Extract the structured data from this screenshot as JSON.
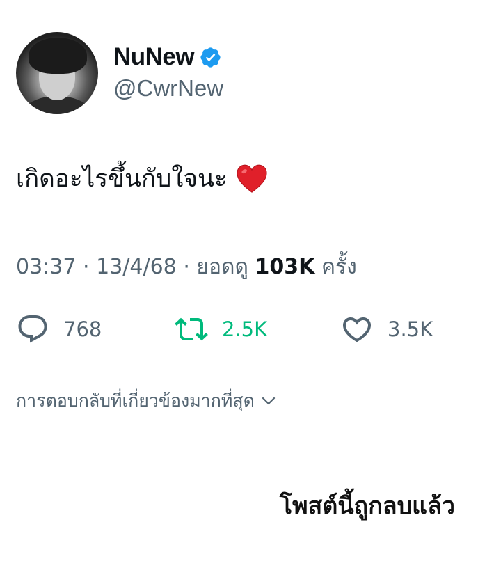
{
  "profile": {
    "display_name": "NuNew",
    "handle": "@CwrNew",
    "verified": true,
    "avatar_icon": "avatar-photo",
    "verified_icon": "verified-badge-icon",
    "verified_color": "#1d9bf0"
  },
  "tweet": {
    "text": "เกิดอะไรขึ้นกับใจนะ",
    "emoji_icon": "red-heart-emoji"
  },
  "meta": {
    "time": "03:37",
    "date": "13/4/68",
    "views_label": "ยอดดู",
    "views_count": "103K",
    "views_unit": "ครั้ง",
    "separator": "·"
  },
  "actions": {
    "replies": {
      "icon": "reply-icon",
      "count": "768"
    },
    "retweets": {
      "icon": "retweet-icon",
      "count": "2.5K",
      "color": "#00ba7c"
    },
    "likes": {
      "icon": "heart-icon",
      "count": "3.5K"
    }
  },
  "replies_sort": {
    "label": "การตอบกลับที่เกี่ยวข้องมากที่สุด",
    "icon": "chevron-down-icon"
  },
  "overlay": {
    "deleted_text": "โพสต์นี้ถูกลบแล้ว"
  },
  "colors": {
    "text": "#0f1419",
    "secondary": "#536471",
    "accent_blue": "#1d9bf0",
    "retweet_green": "#00ba7c",
    "heart_red": "#e0202a"
  }
}
